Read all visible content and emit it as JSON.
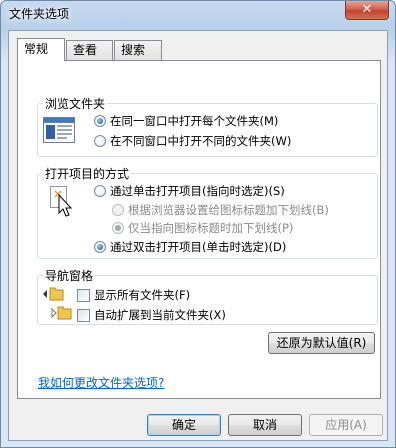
{
  "window": {
    "title": "文件夹选项",
    "close_glyph": "✕"
  },
  "tabs": [
    {
      "label": "常规",
      "active": true
    },
    {
      "label": "查看",
      "active": false
    },
    {
      "label": "搜索",
      "active": false
    }
  ],
  "browse": {
    "title": "浏览文件夹",
    "options": [
      {
        "label": "在同一窗口中打开每个文件夹(M)",
        "checked": true
      },
      {
        "label": "在不同窗口中打开不同的文件夹(W)",
        "checked": false
      }
    ]
  },
  "click": {
    "title": "打开项目的方式",
    "single": {
      "label": "通过单击打开项目(指向时选定)(S)",
      "checked": false
    },
    "underline_browser": {
      "label": "根据浏览器设置给图标标题加下划线(B)",
      "checked": false
    },
    "underline_point": {
      "label": "仅当指向图标标题时加下划线(P)",
      "checked": true
    },
    "double": {
      "label": "通过双击打开项目(单击时选定)(D)",
      "checked": true
    }
  },
  "nav": {
    "title": "导航窗格",
    "show_all": {
      "label": "显示所有文件夹(F)",
      "checked": false
    },
    "auto_expand": {
      "label": "自动扩展到当前文件夹(X)",
      "checked": false
    }
  },
  "restore_button": "还原为默认值(R)",
  "help_link": "我如何更改文件夹选项?",
  "buttons": {
    "ok": "确定",
    "cancel": "取消",
    "apply": "应用(A)"
  }
}
